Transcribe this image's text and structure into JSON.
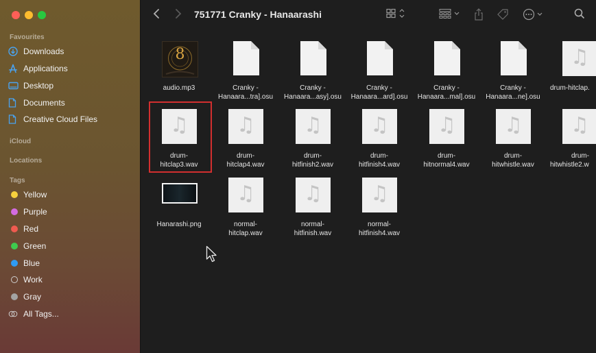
{
  "window": {
    "title": "751771 Cranky - Hanaarashi"
  },
  "sidebar": {
    "sections": {
      "favourites": "Favourites",
      "icloud": "iCloud",
      "locations": "Locations",
      "tags": "Tags"
    },
    "favourites": [
      {
        "label": "Downloads",
        "icon": "download-icon"
      },
      {
        "label": "Applications",
        "icon": "applications-icon"
      },
      {
        "label": "Desktop",
        "icon": "desktop-icon"
      },
      {
        "label": "Documents",
        "icon": "document-icon"
      },
      {
        "label": "Creative Cloud Files",
        "icon": "document-icon"
      }
    ],
    "tags": [
      {
        "label": "Yellow",
        "color": "#f7d13d"
      },
      {
        "label": "Purple",
        "color": "#d36be0"
      },
      {
        "label": "Red",
        "color": "#ef5b50"
      },
      {
        "label": "Green",
        "color": "#3ecb4e"
      },
      {
        "label": "Blue",
        "color": "#2f9bf3"
      },
      {
        "label": "Work",
        "color": "outline"
      },
      {
        "label": "Gray",
        "color": "#a3a3a3"
      },
      {
        "label": "All Tags...",
        "color": "all"
      }
    ]
  },
  "files": [
    {
      "line1": "audio.mp3",
      "line2": "",
      "type": "album-art"
    },
    {
      "line1": "Cranky -",
      "line2": "Hanaara...tra].osu",
      "type": "document"
    },
    {
      "line1": "Cranky -",
      "line2": "Hanaara...asy].osu",
      "type": "document"
    },
    {
      "line1": "Cranky -",
      "line2": "Hanaara...ard].osu",
      "type": "document"
    },
    {
      "line1": "Cranky -",
      "line2": "Hanaara...mal].osu",
      "type": "document"
    },
    {
      "line1": "Cranky -",
      "line2": "Hanaara...ne].osu",
      "type": "document"
    },
    {
      "line1": "drum-hitclap.",
      "line2": "",
      "type": "audio"
    },
    {
      "line1": "drum-",
      "line2": "hitclap3.wav",
      "type": "audio",
      "selected": true
    },
    {
      "line1": "drum-",
      "line2": "hitclap4.wav",
      "type": "audio"
    },
    {
      "line1": "drum-",
      "line2": "hitfinish2.wav",
      "type": "audio"
    },
    {
      "line1": "drum-",
      "line2": "hitfinish4.wav",
      "type": "audio"
    },
    {
      "line1": "drum-",
      "line2": "hitnormal4.wav",
      "type": "audio"
    },
    {
      "line1": "drum-",
      "line2": "hitwhistle.wav",
      "type": "audio"
    },
    {
      "line1": "drum-",
      "line2": "hitwhistle2.w",
      "type": "audio"
    },
    {
      "line1": "Hanarashi.png",
      "line2": "",
      "type": "image"
    },
    {
      "line1": "normal-",
      "line2": "hitclap.wav",
      "type": "audio"
    },
    {
      "line1": "normal-",
      "line2": "hitfinish.wav",
      "type": "audio"
    },
    {
      "line1": "normal-",
      "line2": "hitfinish4.wav",
      "type": "audio"
    }
  ],
  "album_art": {
    "glyph": "8"
  },
  "music_glyph": "♫"
}
